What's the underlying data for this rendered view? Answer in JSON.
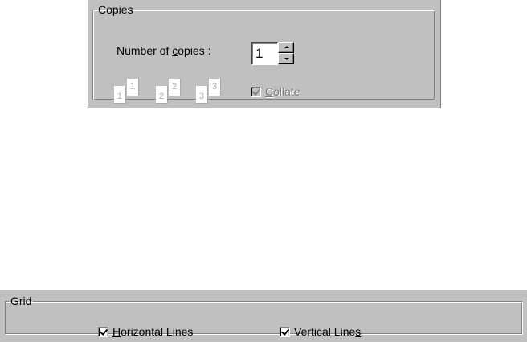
{
  "copies": {
    "group_title": "Copies",
    "number_label_pre": "Number of ",
    "number_label_mnemonic": "c",
    "number_label_post": "opies :",
    "value": "1",
    "page_stacks": [
      {
        "back": "1",
        "front": "1"
      },
      {
        "back": "2",
        "front": "2"
      },
      {
        "back": "3",
        "front": "3"
      }
    ],
    "collate_mnemonic": "C",
    "collate_rest": "ollate",
    "collate_checked": true,
    "collate_enabled": false
  },
  "grid": {
    "group_title": "Grid",
    "horizontal_mnemonic": "H",
    "horizontal_rest": "orizontal Lines",
    "horizontal_checked": true,
    "vertical_pre": "Vertical Line",
    "vertical_mnemonic": "s",
    "vertical_checked": true
  }
}
